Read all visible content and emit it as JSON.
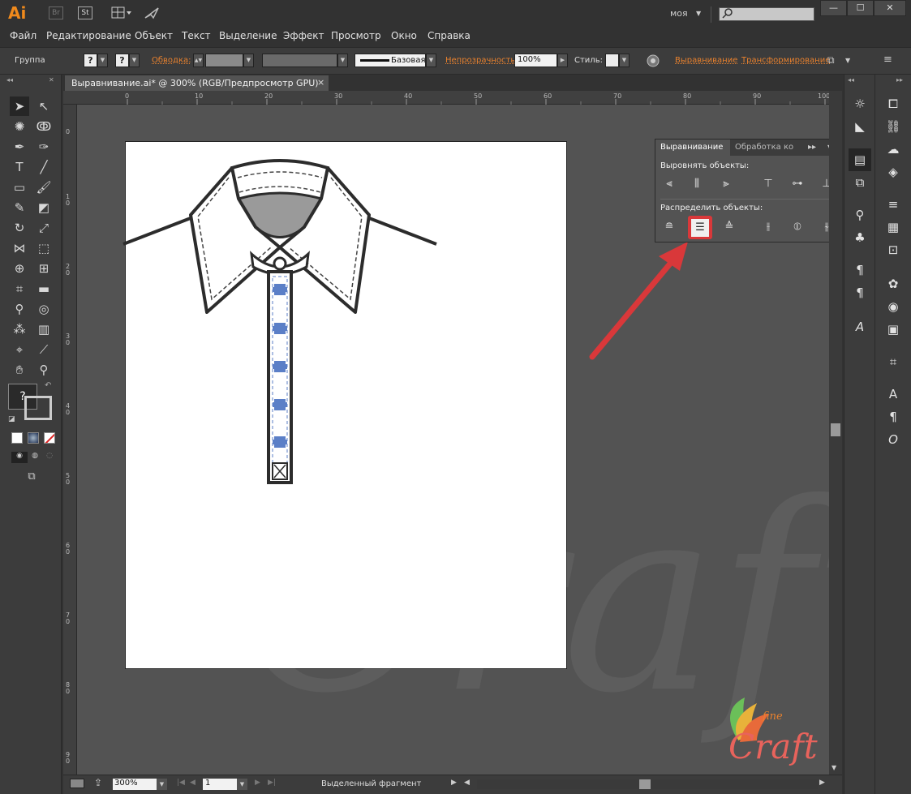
{
  "app": {
    "logo": "Ai",
    "br": "Br",
    "st": "St",
    "workspace": "моя",
    "search_placeholder": ""
  },
  "menu": [
    "Файл",
    "Редактирование",
    "Объект",
    "Текст",
    "Выделение",
    "Эффект",
    "Просмотр",
    "Окно",
    "Справка"
  ],
  "control": {
    "group_label": "Группа",
    "stroke_label": "Обводка:",
    "stroke_style": "Базовая",
    "opacity_label": "Непрозрачность:",
    "opacity_value": "100%",
    "style_label": "Стиль:",
    "align_link": "Выравнивание",
    "transform_link": "Трансформирование"
  },
  "document": {
    "tab_title": "Выравнивание.ai* @ 300% (RGB/Предпросмотр GPU)",
    "close": "×"
  },
  "ruler": {
    "top": [
      "0",
      "10",
      "20",
      "30",
      "40",
      "50",
      "60",
      "70",
      "80",
      "90",
      "100"
    ],
    "left": [
      "0",
      "1\n0",
      "2\n0",
      "3\n0",
      "4\n0",
      "5\n0",
      "6\n0",
      "7\n0",
      "8\n0",
      "9\n0"
    ]
  },
  "align_panel": {
    "tab_active": "Выравнивание",
    "tab_inactive": "Обработка ко",
    "align_objects_label": "Выровнять объекты:",
    "distribute_objects_label": "Распределить объекты:"
  },
  "status": {
    "zoom": "300%",
    "artboard": "1",
    "selection": "Выделенный фрагмент"
  },
  "watermark": {
    "text1": "fine",
    "text2": "Craft"
  },
  "colors": {
    "accent_orange": "#e8812e",
    "highlight_red": "#d9383a",
    "button_blue": "#5b7fc7"
  }
}
